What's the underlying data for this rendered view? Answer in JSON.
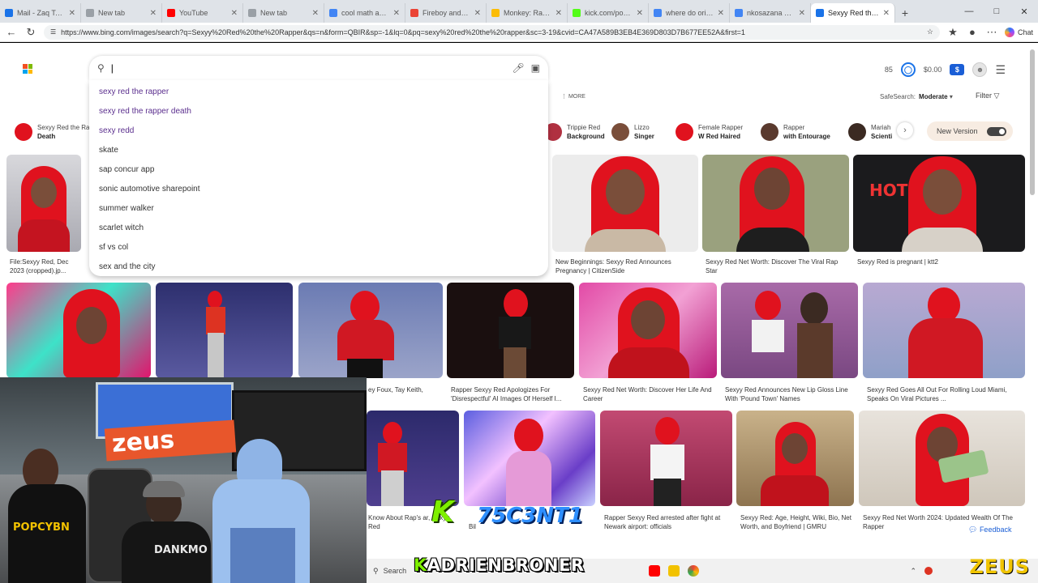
{
  "tabs": [
    {
      "title": "Mail - Zaq Taylor",
      "color": "#1a73e8"
    },
    {
      "title": "New tab",
      "color": "#9aa0a6"
    },
    {
      "title": "YouTube",
      "color": "#ff0000"
    },
    {
      "title": "New tab",
      "color": "#9aa0a6"
    },
    {
      "title": "cool math among us",
      "color": "#4285f4"
    },
    {
      "title": "Fireboy and Water",
      "color": "#ea4335"
    },
    {
      "title": "Monkey: Random",
      "color": "#fbbc05"
    },
    {
      "title": "kick.com/popcorn",
      "color": "#53fc18"
    },
    {
      "title": "where do original",
      "color": "#4285f4"
    },
    {
      "title": "nkosazana daug",
      "color": "#4285f4"
    },
    {
      "title": "Sexyy Red the Rap",
      "color": "#1a73e8",
      "active": true
    }
  ],
  "address": {
    "url": "https://www.bing.com/images/search?q=Sexyy%20Red%20the%20Rapper&qs=n&form=QBIR&sp=-1&lq=0&pq=sexy%20red%20the%20rapper&sc=3-19&cvid=CA47A589B3EB4E369D803D7B677EE52A&first=1",
    "chat_label": "Chat"
  },
  "header": {
    "search_value": "|",
    "points": "85",
    "balance": "$0.00",
    "more_label": "MORE",
    "safesearch_label": "SafeSearch:",
    "safesearch_value": "Moderate",
    "filter_label": "Filter",
    "new_version_label": "New Version"
  },
  "suggestions": [
    {
      "text": "sexy red the rapper",
      "visited": true
    },
    {
      "text": "sexy red the rapper death",
      "visited": true
    },
    {
      "text": "sexy redd",
      "visited": true
    },
    {
      "text": "skate",
      "visited": false
    },
    {
      "text": "sap concur app",
      "visited": false
    },
    {
      "text": "sonic automotive sharepoint",
      "visited": false
    },
    {
      "text": "summer walker",
      "visited": false
    },
    {
      "text": "scarlet witch",
      "visited": false
    },
    {
      "text": "sf vs col",
      "visited": false
    },
    {
      "text": "sex and the city",
      "visited": false
    }
  ],
  "pills": [
    {
      "line1": "Sexyy Red the Ra",
      "line2": "Death"
    },
    {
      "line1": "Trippie Red",
      "line2": "Background"
    },
    {
      "line1": "Lizzo",
      "line2": "Singer"
    },
    {
      "line1": "Female Rapper",
      "line2": "W Red Haired"
    },
    {
      "line1": "Rapper",
      "line2": "with Entourage"
    },
    {
      "line1": "Mariah",
      "line2": "Scienti"
    }
  ],
  "captions": {
    "r1": [
      "File:Sexyy Red, Dec 2023 (cropped).jp...",
      "New Beginnings: Sexyy Red Announces Pregnancy | CitizenSide",
      "Sexyy Red Net Worth: Discover The Viral Rap Star",
      "Sexyy Red is pregnant | ktt2"
    ],
    "r2": [
      "ey Foux, Tay Keith,",
      "Rapper Sexyy Red Apologizes For 'Disrespectful' AI Images Of Herself I...",
      "Sexyy Red Net Worth: Discover Her Life And Career",
      "Sexyy Red Announces New Lip Gloss Line With 'Pound Town' Names",
      "Sexyy Red Goes All Out For Rolling Loud Miami, Speaks On Viral Pictures ..."
    ],
    "r3": [
      "Know About Rap's ar, Sexyy Red",
      "Bil",
      "Rapper Sexyy Red arrested after fight at Newark airport: officials",
      "Sexyy Red: Age, Height, Wiki, Bio, Net Worth, and Boyfriend | GMRU",
      "Sexyy Red Net Worth 2024: Updated Wealth Of The Rapper"
    ]
  },
  "feedback_label": "Feedback",
  "taskbar": {
    "search_label": "Search"
  },
  "overlays": {
    "k_logo": "K",
    "tag_logo": "75C3NT1",
    "adrien_first": "K",
    "adrien_rest": "ADRIENBRONER",
    "zeus": "ZEUS",
    "webcam_banner": "zeus",
    "shirt_text": "POPCYBN",
    "shirt_text2": "DANKMO"
  },
  "colors": {
    "accent": "#1a5ed6",
    "visited_link": "#5b2f8e",
    "hair_red": "#e0121e"
  }
}
